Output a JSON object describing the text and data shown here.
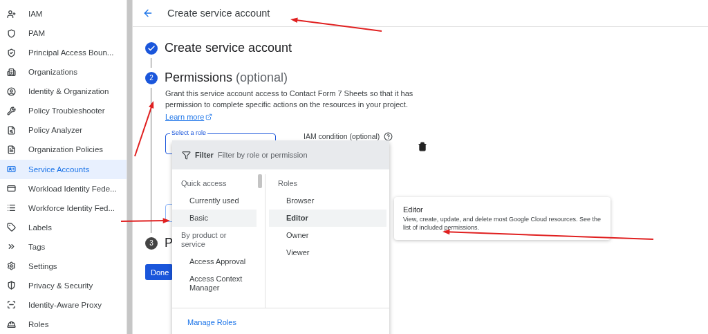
{
  "sidebar": {
    "items": [
      {
        "label": "IAM",
        "selected": false
      },
      {
        "label": "PAM",
        "selected": false
      },
      {
        "label": "Principal Access Boun...",
        "selected": false
      },
      {
        "label": "Organizations",
        "selected": false
      },
      {
        "label": "Identity & Organization",
        "selected": false
      },
      {
        "label": "Policy Troubleshooter",
        "selected": false
      },
      {
        "label": "Policy Analyzer",
        "selected": false
      },
      {
        "label": "Organization Policies",
        "selected": false
      },
      {
        "label": "Service Accounts",
        "selected": true
      },
      {
        "label": "Workload Identity Fede...",
        "selected": false
      },
      {
        "label": "Workforce Identity Fed...",
        "selected": false
      },
      {
        "label": "Labels",
        "selected": false
      },
      {
        "label": "Tags",
        "selected": false
      },
      {
        "label": "Settings",
        "selected": false
      },
      {
        "label": "Privacy & Security",
        "selected": false
      },
      {
        "label": "Identity-Aware Proxy",
        "selected": false
      },
      {
        "label": "Roles",
        "selected": false
      }
    ]
  },
  "header": {
    "title": "Create service account"
  },
  "steps": [
    {
      "title": "Create service account",
      "completed": true
    },
    {
      "number": "2",
      "title": "Permissions",
      "title_suffix": "(optional)",
      "completed": false,
      "active": true,
      "description": "Grant this service account access to Contact Form 7 Sheets so that it has permission to complete specific actions on the resources in your project.",
      "link": "Learn more"
    },
    {
      "number": "3",
      "title": "P",
      "completed": false,
      "active": false
    }
  ],
  "role_field": {
    "label": "Select a role"
  },
  "condition_label": "IAM condition (optional)",
  "done_button": "Done",
  "role_menu": {
    "filter_label": "Filter",
    "filter_placeholder": "Filter by role or permission",
    "categories": [
      {
        "label": "Quick access",
        "kind": "heading",
        "selected": false
      },
      {
        "label": "Currently used",
        "kind": "item",
        "selected": false
      },
      {
        "label": "Basic",
        "kind": "item",
        "selected": true
      },
      {
        "label": "By product or service",
        "kind": "heading",
        "selected": false
      },
      {
        "label": "Access Approval",
        "kind": "item",
        "selected": false
      },
      {
        "label": "Access Context Manager",
        "kind": "item",
        "selected": false
      }
    ],
    "roles": [
      {
        "label": "Roles",
        "kind": "heading",
        "selected": false
      },
      {
        "label": "Browser",
        "kind": "item",
        "selected": false
      },
      {
        "label": "Editor",
        "kind": "item",
        "selected": true
      },
      {
        "label": "Owner",
        "kind": "item",
        "selected": false
      },
      {
        "label": "Viewer",
        "kind": "item",
        "selected": false
      }
    ],
    "footer_link": "Manage Roles"
  },
  "role_tooltip": {
    "title": "Editor",
    "description": "View, create, update, and delete most Google Cloud resources. See the list of included permissions."
  }
}
